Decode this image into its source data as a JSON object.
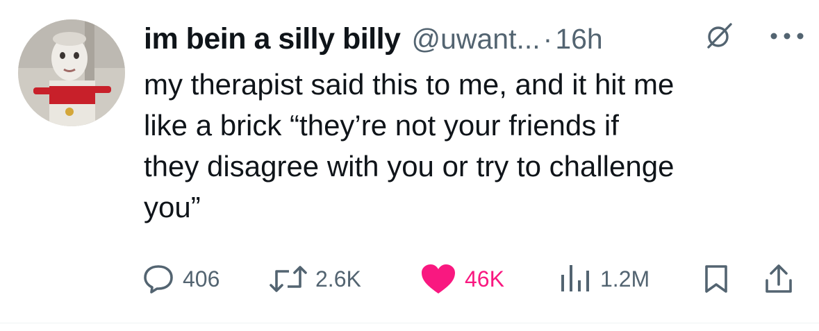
{
  "tweet": {
    "display_name": "im bein a silly billy",
    "handle": "@uwant...",
    "separator": "·",
    "time": "16h",
    "text_lines": [
      "my therapist said this to me, and it hit me",
      "like a brick “they’re not your friends if",
      "they disagree with you or try to challenge",
      "you”"
    ]
  },
  "actions": {
    "replies": "406",
    "reposts": "2.6K",
    "likes": "46K",
    "views": "1.2M"
  },
  "colors": {
    "text": "#0f1419",
    "secondary": "#536471",
    "like": "#f91880",
    "divider": "#eff3f4"
  },
  "icons": {
    "reply": "reply-icon",
    "repost": "repost-icon",
    "like": "heart-icon",
    "views": "views-chart-icon",
    "bookmark": "bookmark-icon",
    "share": "share-icon",
    "grok": "grok-icon",
    "more": "more-icon"
  }
}
